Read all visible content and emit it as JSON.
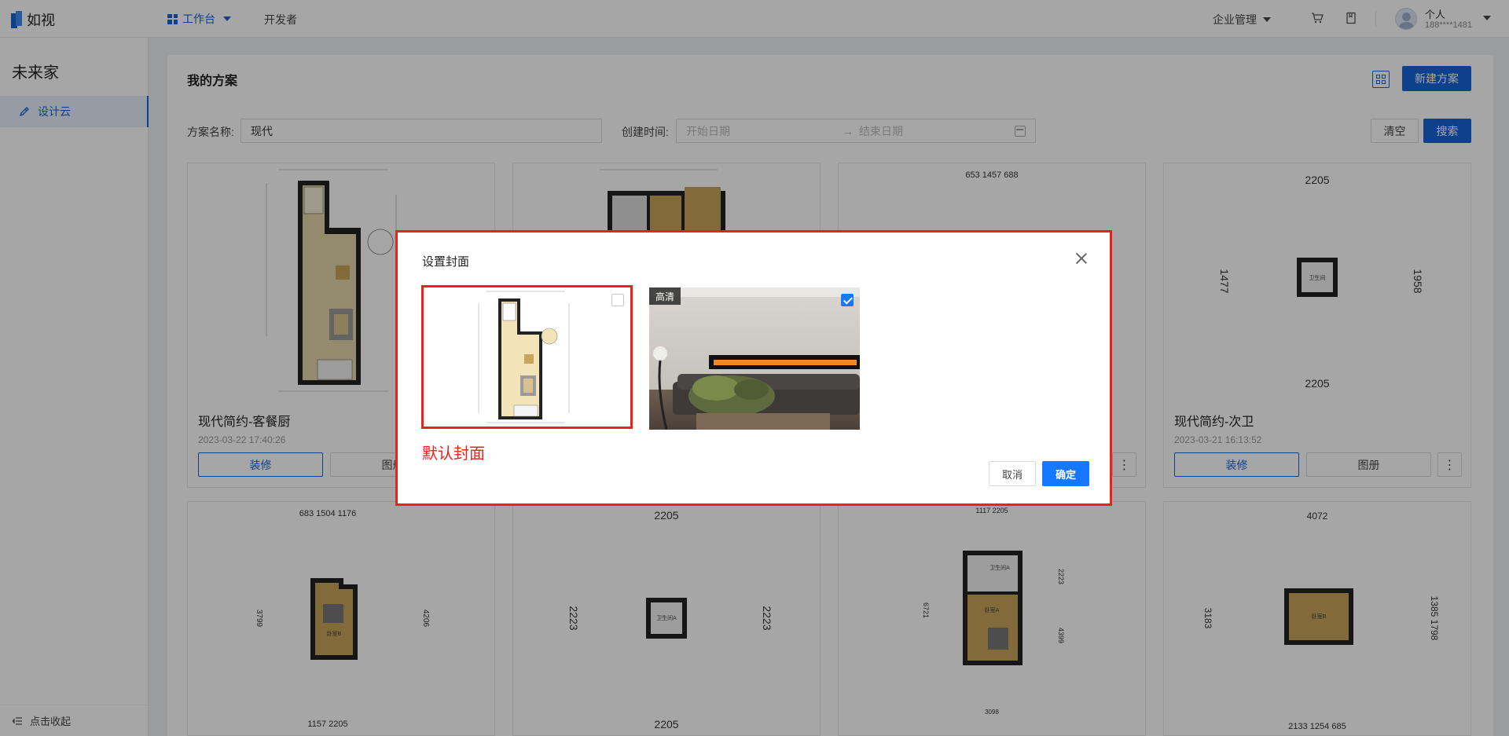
{
  "header": {
    "logo_text": "如视",
    "nav_workbench": "工作台",
    "nav_developer": "开发者",
    "enterprise_mgmt": "企业管理",
    "user_name": "个人",
    "user_phone": "188****1481",
    "icons": [
      "cart-icon",
      "book-icon",
      "avatar"
    ]
  },
  "sidebar": {
    "title": "未来家",
    "items": [
      {
        "label": "设计云",
        "icon": "design-cloud-icon",
        "active": true
      }
    ],
    "collapse_label": "点击收起"
  },
  "main": {
    "page_title": "我的方案",
    "new_button": "新建方案",
    "filters": {
      "name_label": "方案名称:",
      "name_value": "现代",
      "date_label": "创建时间:",
      "start_placeholder": "开始日期",
      "arrow": "→",
      "end_placeholder": "结束日期",
      "clear_label": "清空",
      "search_label": "搜索"
    },
    "cards": [
      {
        "title": "现代简约-客餐厨",
        "date": "2023-03-22 17:40:26",
        "decorate_label": "装修",
        "album_label": "图册",
        "more": "⋮"
      },
      {
        "title": "",
        "date": "",
        "decorate_label": "",
        "album_label": "",
        "more": ""
      },
      {
        "title": "",
        "date": "",
        "decorate_label": "",
        "album_label": "",
        "more": "⋮"
      },
      {
        "title": "现代简约-次卫",
        "date": "2023-03-21 16:13:52",
        "decorate_label": "装修",
        "album_label": "图册",
        "more": "⋮"
      }
    ],
    "plan_dims": {
      "c3_top": "653 1457 688",
      "c4_top": "2205",
      "c4_left": "1477",
      "c4_right": "1958",
      "c4_bottom": "2205",
      "r2c1_top": "683 1504 1176",
      "r2c1_left": "3799",
      "r2c1_right": "4206",
      "r2c1_bottom": "1157 2205",
      "r2c2_top": "2205",
      "r2c2_left": "2223",
      "r2c2_right": "2223",
      "r2c2_bottom": "2205",
      "r2c3_top": "1117 2205",
      "r2c3_left": "6721",
      "r2c3_right": "2223",
      "r2c3_right2": "4399",
      "r2c3_bottom": "3098",
      "r2c4_top": "4072",
      "r2c4_left": "3183",
      "r2c4_right": "1385 1798",
      "r2c4_bottom": "2133 1254 685"
    },
    "room_labels": {
      "bath": "卫生间",
      "bedroom": "卧室",
      "bedroom_a": "卧室A",
      "bedroom_b": "卧室B",
      "bath_a": "卫生间A"
    }
  },
  "modal": {
    "title": "设置封面",
    "hd_badge": "高清",
    "default_cover_label": "默认封面",
    "cancel_label": "取消",
    "ok_label": "确定",
    "hd_checked": true,
    "default_checked": false
  },
  "colors": {
    "primary": "#1464d8",
    "modal_highlight": "#e8231c",
    "checkbox_blue": "#1677ff",
    "floor_wood": "#d6b877",
    "floor_light": "#f3e3b8"
  }
}
